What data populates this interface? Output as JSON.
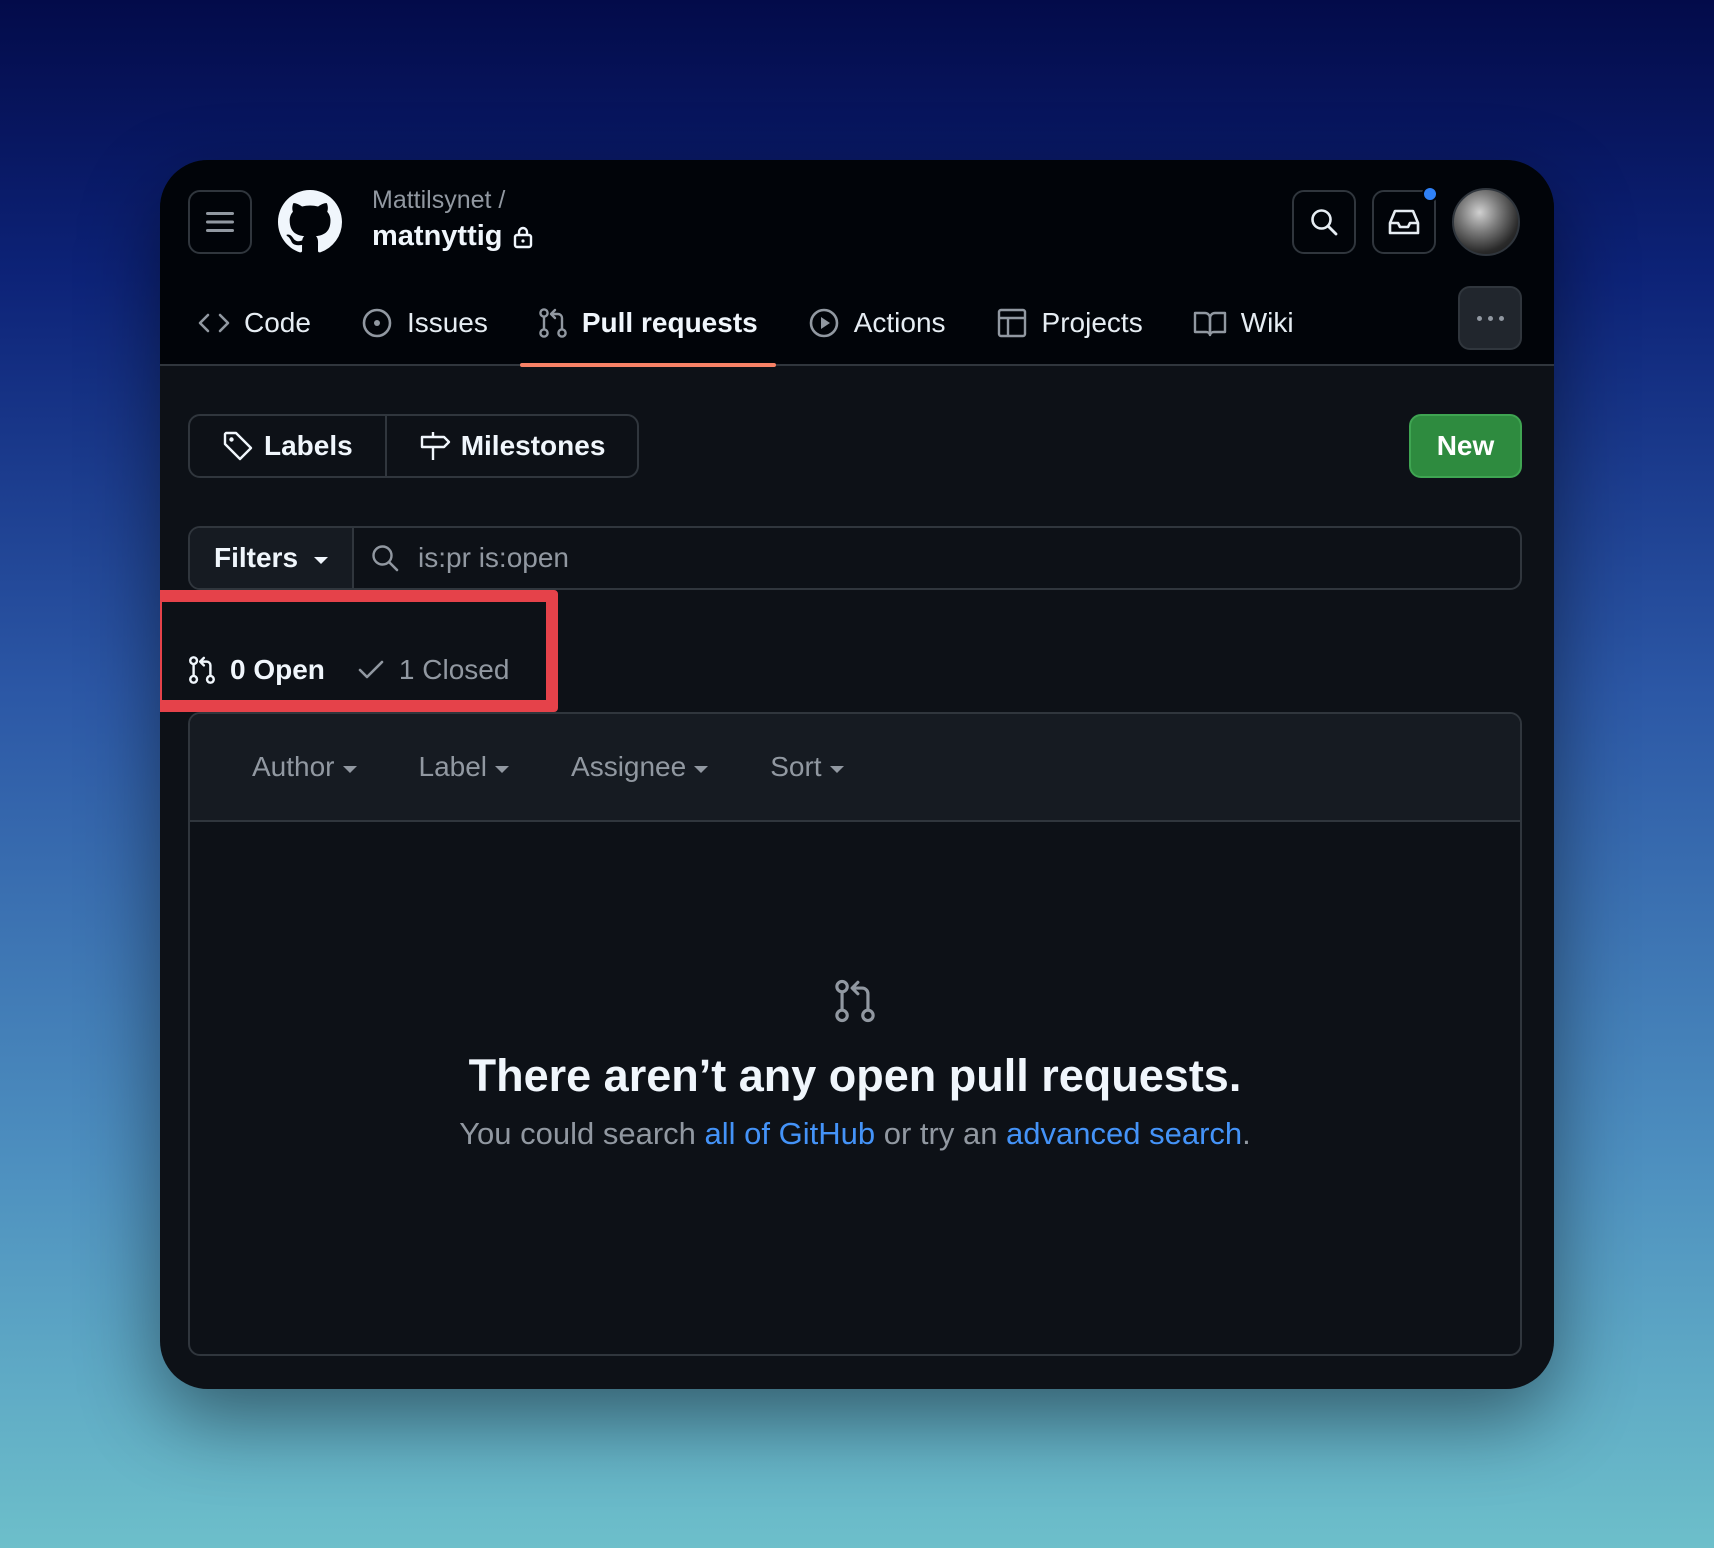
{
  "header": {
    "owner": "Mattilsynet /",
    "repo": "matnyttig"
  },
  "nav": {
    "code": "Code",
    "issues": "Issues",
    "pull_requests": "Pull requests",
    "actions": "Actions",
    "projects": "Projects",
    "wiki": "Wiki"
  },
  "toolbar": {
    "labels": "Labels",
    "milestones": "Milestones",
    "new": "New"
  },
  "filterbar": {
    "filters": "Filters",
    "query": "is:pr is:open"
  },
  "states": {
    "open": "0 Open",
    "closed": "1 Closed"
  },
  "list_header": {
    "author": "Author",
    "label": "Label",
    "assignee": "Assignee",
    "sort": "Sort"
  },
  "blankslate": {
    "title": "There aren’t any open pull requests.",
    "desc_prefix": "You could search ",
    "link_all": "all of GitHub",
    "desc_middle": " or try an ",
    "link_advanced": "advanced search",
    "desc_suffix": "."
  },
  "colors": {
    "accent_underline": "#f78166",
    "new_button": "#2e8b3f",
    "link": "#4493f8",
    "highlight_box": "#e5424a"
  }
}
